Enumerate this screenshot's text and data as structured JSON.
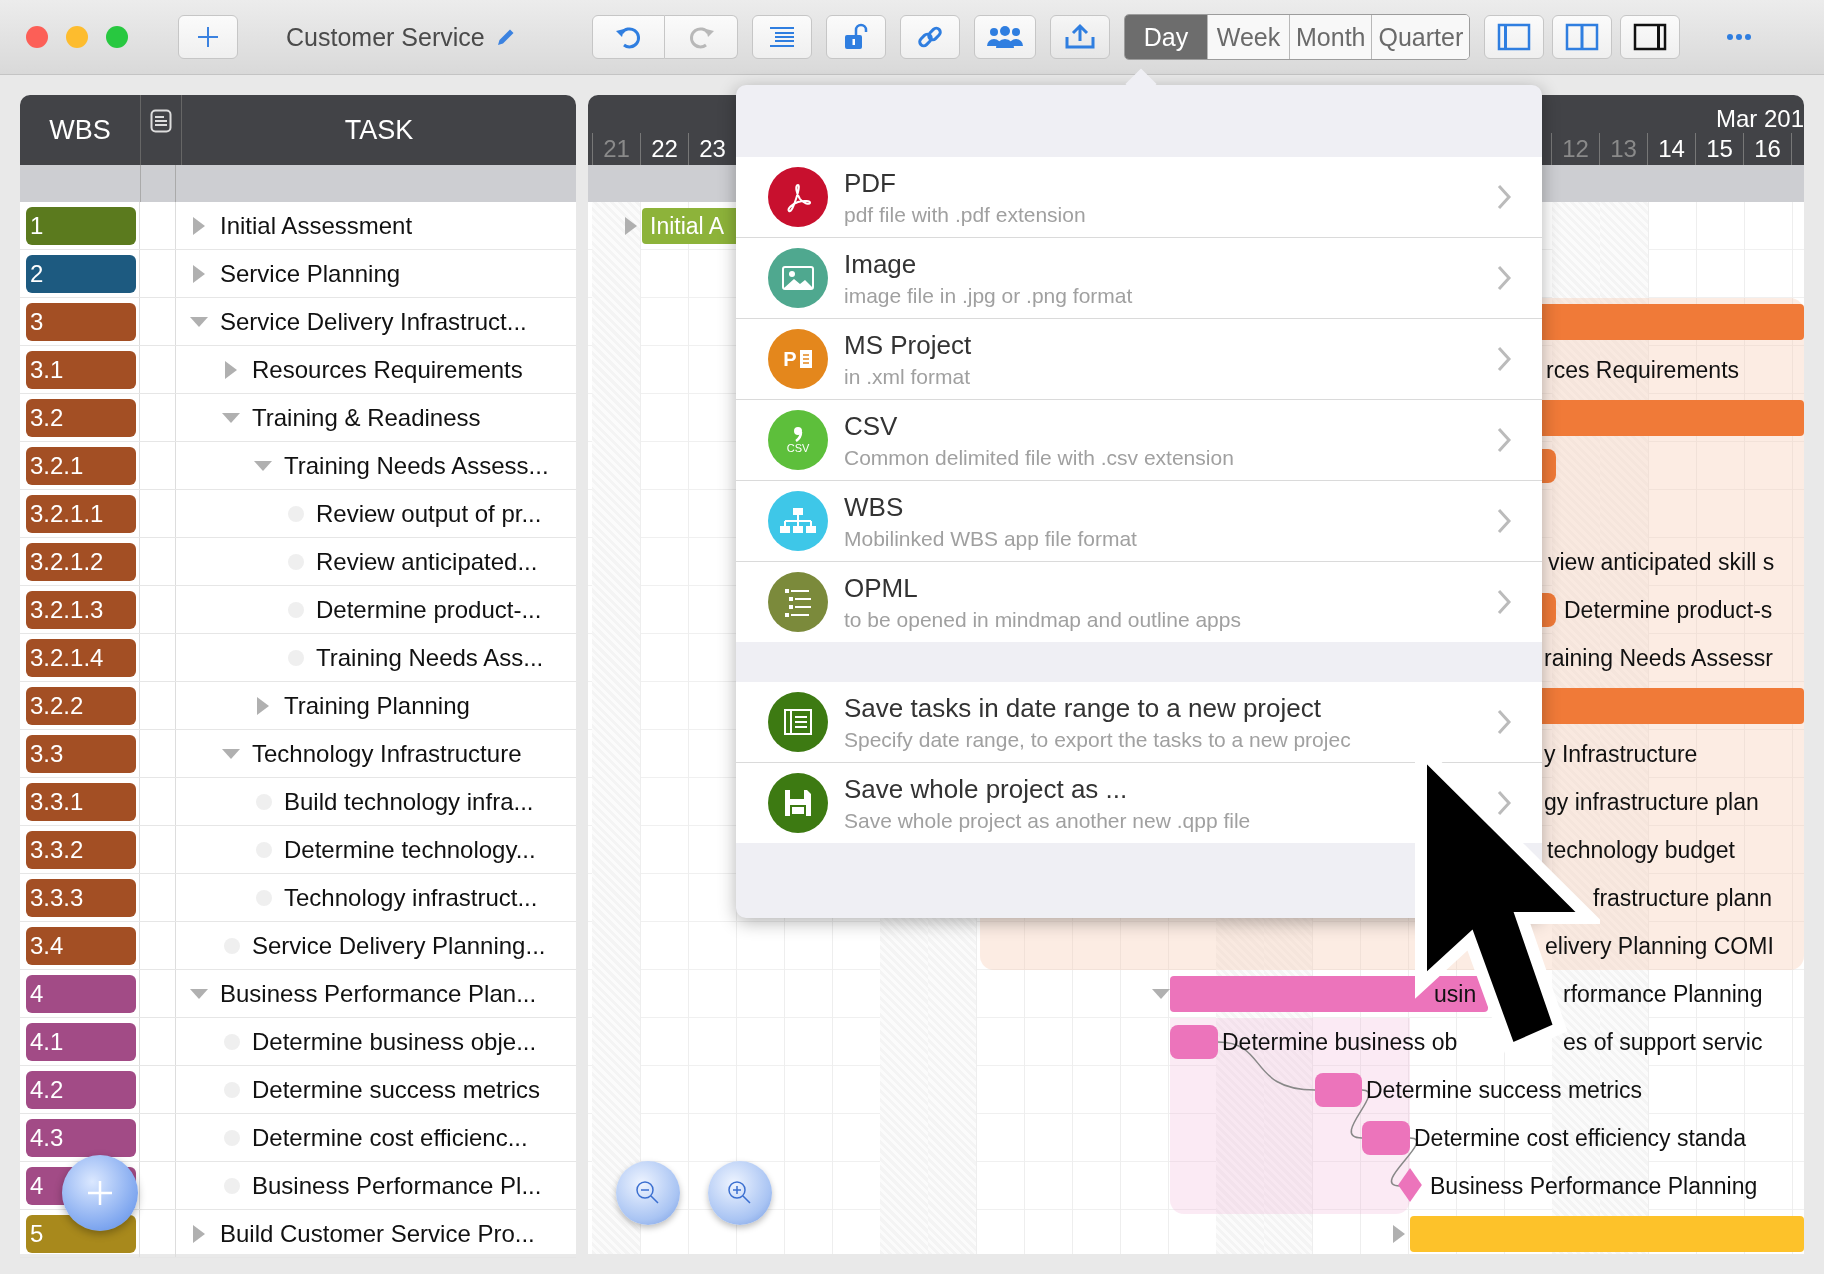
{
  "window": {
    "title": "Customer Service"
  },
  "toolbar": {
    "view_modes": [
      {
        "label": "Day",
        "selected": true
      },
      {
        "label": "Week",
        "selected": false
      },
      {
        "label": "Month",
        "selected": false
      },
      {
        "label": "Quarter",
        "selected": false
      }
    ],
    "layouts": [
      {
        "selected": false
      },
      {
        "selected": false
      },
      {
        "selected": true
      }
    ]
  },
  "table": {
    "columns": [
      "WBS",
      "TASK"
    ],
    "tasks": [
      {
        "wbs": "1",
        "color": "#5b7a1e",
        "name": "Initial Assessment",
        "expanded": false
      },
      {
        "wbs": "2",
        "color": "#1d5a80",
        "name": "Service Planning",
        "expanded": false
      },
      {
        "wbs": "3",
        "color": "#a34f24",
        "name": "Service Delivery Infrastruct...",
        "expanded": true,
        "children": [
          {
            "wbs": "3.1",
            "color": "#a34f24",
            "name": "Resources Requirements",
            "expanded": false
          },
          {
            "wbs": "3.2",
            "color": "#a34f24",
            "name": "Training & Readiness",
            "expanded": true,
            "children": [
              {
                "wbs": "3.2.1",
                "color": "#a34f24",
                "name": "Training Needs Assess...",
                "expanded": true,
                "children": [
                  {
                    "wbs": "3.2.1.1",
                    "color": "#a34f24",
                    "name": "Review output of pr..."
                  },
                  {
                    "wbs": "3.2.1.2",
                    "color": "#a34f24",
                    "name": "Review anticipated..."
                  },
                  {
                    "wbs": "3.2.1.3",
                    "color": "#a34f24",
                    "name": "Determine product-..."
                  },
                  {
                    "wbs": "3.2.1.4",
                    "color": "#a34f24",
                    "name": "Training Needs Ass..."
                  }
                ]
              },
              {
                "wbs": "3.2.2",
                "color": "#a34f24",
                "name": "Training Planning",
                "expanded": false
              }
            ]
          },
          {
            "wbs": "3.3",
            "color": "#a34f24",
            "name": "Technology Infrastructure",
            "expanded": true,
            "children": [
              {
                "wbs": "3.3.1",
                "color": "#a34f24",
                "name": "Build technology infra..."
              },
              {
                "wbs": "3.3.2",
                "color": "#a34f24",
                "name": "Determine technology..."
              },
              {
                "wbs": "3.3.3",
                "color": "#a34f24",
                "name": "Technology infrastruct..."
              }
            ]
          },
          {
            "wbs": "3.4",
            "color": "#a34f24",
            "name": "Service Delivery Planning..."
          }
        ]
      },
      {
        "wbs": "4",
        "color": "#a24b86",
        "name": "Business Performance Plan...",
        "expanded": true,
        "children": [
          {
            "wbs": "4.1",
            "color": "#a24b86",
            "name": "Determine business obje..."
          },
          {
            "wbs": "4.2",
            "color": "#a24b86",
            "name": "Determine success metrics"
          },
          {
            "wbs": "4.3",
            "color": "#a24b86",
            "name": "Determine cost efficienc..."
          },
          {
            "wbs": "4",
            "color": "#a24b86",
            "name": "Business Performance Pl..."
          }
        ]
      },
      {
        "wbs": "5",
        "color": "#a8891c",
        "name": "Build Customer Service Pro...",
        "expanded": false
      }
    ]
  },
  "gantt": {
    "month": "Mar 201",
    "days": [
      [
        {
          "label": "21",
          "weekend": true
        },
        {
          "label": "22",
          "weekend": false
        },
        {
          "label": "23",
          "weekend": false
        }
      ],
      [
        {
          "label": "12",
          "weekend": true
        },
        {
          "label": "13",
          "weekend": true
        },
        {
          "label": "14",
          "weekend": false
        },
        {
          "label": "15",
          "weekend": false
        },
        {
          "label": "16",
          "weekend": false
        }
      ]
    ],
    "rows": [
      {
        "kind": "summary",
        "color": "#8db33a",
        "expanded": false,
        "labels": [
          "Initial A"
        ]
      },
      {
        "kind": "empty"
      },
      {
        "kind": "summary",
        "color": "#f07a38"
      },
      {
        "kind": "empty",
        "labels": [
          "rces Requirements"
        ]
      },
      {
        "kind": "summary",
        "color": "#f07a38"
      },
      {
        "kind": "task",
        "color": "#f07a38"
      },
      {
        "kind": "empty"
      },
      {
        "kind": "empty",
        "labels": [
          "view anticipated skill s"
        ]
      },
      {
        "kind": "task",
        "color": "#f07a38",
        "labels": [
          "Determine product-s"
        ]
      },
      {
        "kind": "empty",
        "labels": [
          "raining Needs Assessr"
        ]
      },
      {
        "kind": "summary",
        "color": "#f07a38"
      },
      {
        "kind": "empty",
        "labels": [
          "y Infrastructure"
        ]
      },
      {
        "kind": "empty",
        "labels": [
          "gy infrastructure plan"
        ]
      },
      {
        "kind": "empty",
        "labels": [
          "technology budget"
        ]
      },
      {
        "kind": "empty",
        "labels": [
          "frastructure plann"
        ]
      },
      {
        "kind": "empty",
        "labels": [
          "elivery Planning COMI"
        ]
      },
      {
        "kind": "summary",
        "color": "#ec74bb",
        "expanded": true,
        "labels": [
          "usin",
          "rformance Planning"
        ]
      },
      {
        "kind": "task",
        "color": "#ec74bb",
        "labels": [
          "Determine business ob",
          "es of support servic"
        ]
      },
      {
        "kind": "task",
        "color": "#ec74bb",
        "labels": [
          "Determine success metrics"
        ]
      },
      {
        "kind": "task",
        "color": "#ec74bb",
        "labels": [
          "Determine cost efficiency standa"
        ]
      },
      {
        "kind": "milestone",
        "color": "#ec74bb",
        "labels": [
          "Business Performance Planning"
        ]
      },
      {
        "kind": "summary",
        "color": "#fdc22a",
        "expanded": false
      }
    ]
  },
  "export_menu": {
    "groups": [
      [
        {
          "kind": "pdf",
          "color": "#c8102e",
          "title": "PDF",
          "subtitle": "pdf file with .pdf extension"
        },
        {
          "kind": "image",
          "color": "#4fa88f",
          "title": "Image",
          "subtitle": "image file in .jpg or .png format"
        },
        {
          "kind": "msproject",
          "color": "#e4871c",
          "icon_text": "P",
          "title": "MS Project",
          "subtitle": "in .xml format"
        },
        {
          "kind": "csv",
          "color": "#5dbf3b",
          "icon_text": "CSV",
          "title": "CSV",
          "subtitle": "Common delimited file with .csv extension"
        },
        {
          "kind": "wbs",
          "color": "#3ec7e8",
          "title": "WBS",
          "subtitle": "Mobilinked WBS app file format"
        },
        {
          "kind": "opml",
          "color": "#7b8a3b",
          "title": "OPML",
          "subtitle": "to be opened in mindmap and outline apps"
        }
      ],
      [
        {
          "kind": "range",
          "color": "#3d7a12",
          "title": "Save tasks in date range to a new project",
          "subtitle": "Specify date range, to export the tasks to a new projec"
        },
        {
          "kind": "save",
          "color": "#3d7a12",
          "title": "Save whole project as ...",
          "subtitle": "Save whole project as another new .qpp file"
        }
      ]
    ]
  }
}
